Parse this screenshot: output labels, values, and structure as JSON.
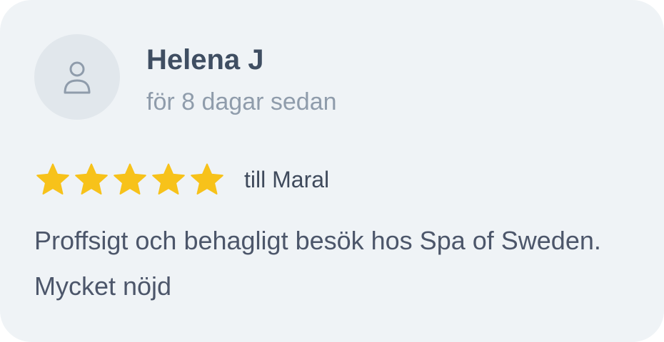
{
  "review": {
    "author_name": "Helena J",
    "time_ago": "för 8 dagar sedan",
    "rating": 5,
    "rating_max": 5,
    "stylist_text": "till Maral",
    "text": "Proffsigt och behagligt besök hos Spa of Sweden. Mycket nöjd",
    "avatar_icon": "user-icon",
    "star_icon": "star-icon"
  },
  "colors": {
    "card_background": "#eff3f6",
    "avatar_background": "#e1e7ec",
    "star": "#f7c21a",
    "name": "#3f4e62",
    "muted": "#8f9cab"
  }
}
